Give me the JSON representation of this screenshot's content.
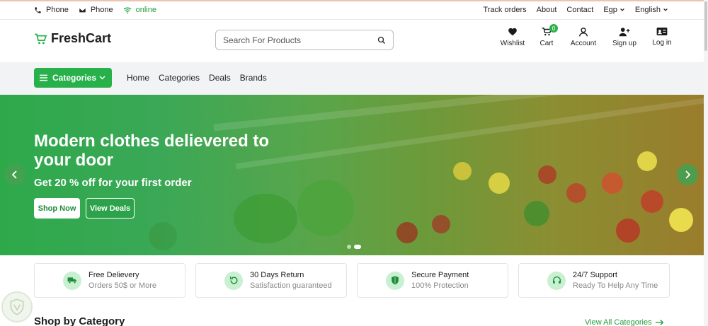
{
  "topbar": {
    "phone1": "Phone",
    "phone2": "Phone",
    "status": "online",
    "links": [
      "Track orders",
      "About",
      "Contact"
    ],
    "currency": "Egp",
    "language": "English"
  },
  "header": {
    "logo": "FreshCart",
    "search_placeholder": "Search For Products",
    "wishlist": "Wishlist",
    "cart": "Cart",
    "cart_count": "0",
    "account": "Account",
    "signup": "Sign up",
    "login": "Log in"
  },
  "nav": {
    "categories_button": "Categories",
    "links": [
      "Home",
      "Categories",
      "Deals",
      "Brands"
    ]
  },
  "hero": {
    "title": "Modern clothes delievered to your door",
    "subtitle": "Get 20 % off for your first order",
    "shop_now": "Shop Now",
    "view_deals": "View Deals"
  },
  "features": [
    {
      "title": "Free Delievery",
      "subtitle": "Orders 50$ or More",
      "icon": "truck-icon"
    },
    {
      "title": "30 Days Return",
      "subtitle": "Satisfaction guaranteed",
      "icon": "return-icon"
    },
    {
      "title": "Secure Payment",
      "subtitle": "100% Protection",
      "icon": "shield-icon"
    },
    {
      "title": "24/7 Support",
      "subtitle": "Ready To Help Any Time",
      "icon": "headset-icon"
    }
  ],
  "section": {
    "title": "Shop by Category",
    "view_all": "View All Categories"
  },
  "colors": {
    "brand": "#28b14a",
    "text": "#222222",
    "nav_bg": "#f1f3f4"
  }
}
